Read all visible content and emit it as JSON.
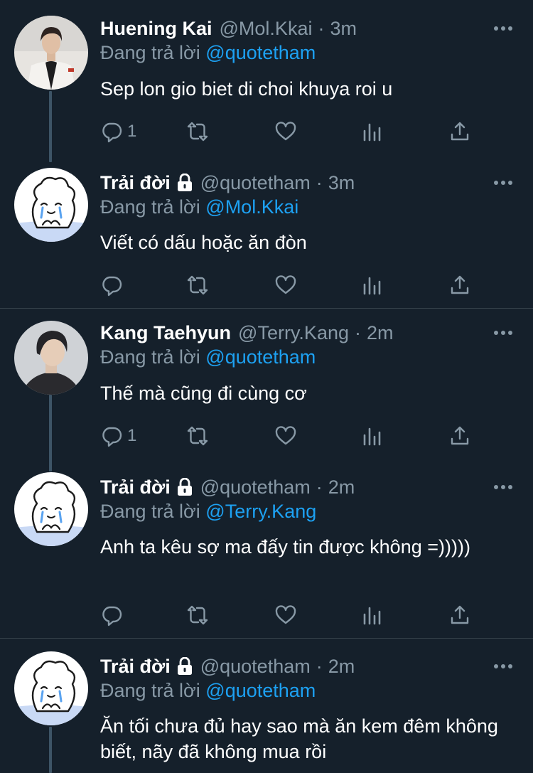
{
  "replying_prefix": "Đang trả lời",
  "tweets": [
    {
      "name": "Huening Kai",
      "handle": "@Mol.Kkai",
      "dot": "·",
      "time": "3m",
      "reply_to": "@quotetham",
      "text": "Sep lon gio biet di choi khuya roi u",
      "reply_count": "1",
      "locked": false
    },
    {
      "name": "Trải đời",
      "handle": "@quotetham",
      "dot": "·",
      "time": "3m",
      "reply_to": "@Mol.Kkai",
      "text": "Viết có dấu hoặc ăn đòn",
      "reply_count": "",
      "locked": true
    },
    {
      "name": "Kang Taehyun",
      "handle": "@Terry.Kang",
      "dot": "·",
      "time": "2m",
      "reply_to": "@quotetham",
      "text": "Thế mà cũng đi cùng cơ",
      "reply_count": "1",
      "locked": false
    },
    {
      "name": "Trải đời",
      "handle": "@quotetham",
      "dot": "·",
      "time": "2m",
      "reply_to": "@Terry.Kang",
      "text": "Anh ta kêu sợ ma đấy tin được không =)))))",
      "reply_count": "",
      "locked": true
    },
    {
      "name": "Trải đời",
      "handle": "@quotetham",
      "dot": "·",
      "time": "2m",
      "reply_to": "@quotetham",
      "text": "Ăn tối chưa đủ hay sao mà ăn kem đêm không biết, nãy đã không mua rồi",
      "reply_count": "",
      "locked": true
    }
  ],
  "colors": {
    "background": "#15202b",
    "secondary_text": "#8899a6",
    "link": "#1da1f2",
    "divider": "#38444d",
    "thread_line": "#3d5466"
  }
}
